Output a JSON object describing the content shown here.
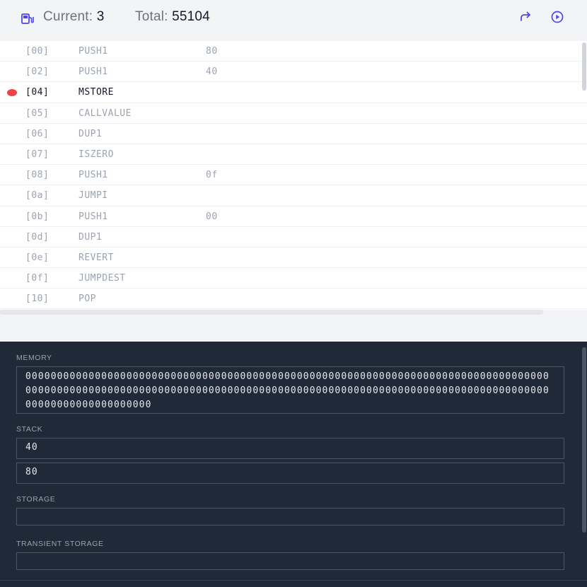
{
  "header": {
    "current_label": "Current:",
    "current_value": "3",
    "total_label": "Total:",
    "total_value": "55104",
    "icons": [
      "gas-pump-icon",
      "redo-icon",
      "play-icon"
    ]
  },
  "instructions": [
    {
      "pc": "[00]",
      "op": "PUSH1",
      "arg": "80"
    },
    {
      "pc": "[02]",
      "op": "PUSH1",
      "arg": "40"
    },
    {
      "pc": "[04]",
      "op": "MSTORE",
      "arg": ""
    },
    {
      "pc": "[05]",
      "op": "CALLVALUE",
      "arg": ""
    },
    {
      "pc": "[06]",
      "op": "DUP1",
      "arg": ""
    },
    {
      "pc": "[07]",
      "op": "ISZERO",
      "arg": ""
    },
    {
      "pc": "[08]",
      "op": "PUSH1",
      "arg": "0f"
    },
    {
      "pc": "[0a]",
      "op": "JUMPI",
      "arg": ""
    },
    {
      "pc": "[0b]",
      "op": "PUSH1",
      "arg": "00"
    },
    {
      "pc": "[0d]",
      "op": "DUP1",
      "arg": ""
    },
    {
      "pc": "[0e]",
      "op": "REVERT",
      "arg": ""
    },
    {
      "pc": "[0f]",
      "op": "JUMPDEST",
      "arg": ""
    },
    {
      "pc": "[10]",
      "op": "POP",
      "arg": ""
    }
  ],
  "active_pc": "[04]",
  "panel": {
    "memory_label": "MEMORY",
    "memory_value": "000000000000000000000000000000000000000000000000000000000000000000000000000000000000000000000000000000000000000000000000000000000000000000000000000000000000000000000000000000000000000000",
    "stack_label": "STACK",
    "stack": [
      "40",
      "80"
    ],
    "storage_label": "STORAGE",
    "transient_label": "TRANSIENT STORAGE"
  },
  "colors": {
    "accent": "#4f46e5",
    "breakpoint": "#ef4444",
    "panel_bg": "#1f2937"
  }
}
